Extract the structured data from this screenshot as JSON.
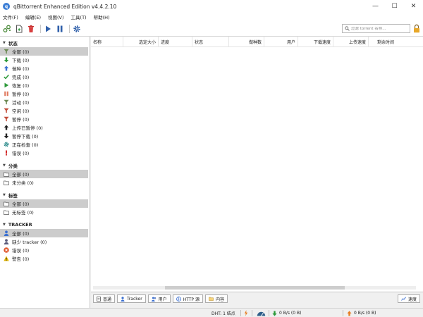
{
  "window": {
    "title": "qBittorrent Enhanced Edition v4.4.2.10",
    "minimize": "—",
    "maximize": "☐",
    "close": "✕"
  },
  "menu": [
    "文件(F)",
    "编辑(E)",
    "视图(V)",
    "工具(T)",
    "帮助(H)"
  ],
  "toolbar": {
    "search_placeholder": "过滤 torrent 名称..."
  },
  "sidebar": {
    "status": {
      "title": "状态",
      "items": [
        {
          "label": "全部 (0)",
          "icon": "filter-icon",
          "color": "#6d8a55"
        },
        {
          "label": "下载 (0)",
          "icon": "down-arrow-icon",
          "color": "#2d9a3a"
        },
        {
          "label": "做种 (0)",
          "icon": "up-arrow-icon",
          "color": "#3a6fd1"
        },
        {
          "label": "完成 (0)",
          "icon": "check-icon",
          "color": "#2d9a3a"
        },
        {
          "label": "恢复 (0)",
          "icon": "play-icon",
          "color": "#2d9a3a"
        },
        {
          "label": "暂停 (0)",
          "icon": "pause-icon",
          "color": "#e07a5f"
        },
        {
          "label": "活动 (0)",
          "icon": "filter-icon",
          "color": "#6d8a55"
        },
        {
          "label": "空闲 (0)",
          "icon": "filter-icon",
          "color": "#c24c3a"
        },
        {
          "label": "暂停 (0)",
          "icon": "filter-icon",
          "color": "#c24c3a"
        },
        {
          "label": "上传已暂停 (0)",
          "icon": "up-arrow-icon",
          "color": "#222222"
        },
        {
          "label": "暂停下载 (0)",
          "icon": "down-arrow-icon",
          "color": "#222222"
        },
        {
          "label": "正在检查 (0)",
          "icon": "gear-icon",
          "color": "#2a8a8a"
        },
        {
          "label": "错误 (0)",
          "icon": "exclamation-icon",
          "color": "#d22b2b"
        }
      ]
    },
    "category": {
      "title": "分类",
      "items": [
        {
          "label": "全部 (0)",
          "icon": "folder-icon",
          "color": "#555555"
        },
        {
          "label": "未分类 (0)",
          "icon": "folder-icon",
          "color": "#555555"
        }
      ]
    },
    "tags": {
      "title": "标签",
      "items": [
        {
          "label": "全部 (0)",
          "icon": "folder-icon",
          "color": "#555555"
        },
        {
          "label": "无标签 (0)",
          "icon": "folder-icon",
          "color": "#555555"
        }
      ]
    },
    "tracker": {
      "title": "TRACKER",
      "items": [
        {
          "label": "全部 (0)",
          "icon": "user-icon",
          "color": "#3a6fd1"
        },
        {
          "label": "缺少 tracker (0)",
          "icon": "user-icon",
          "color": "#5a5a7a"
        },
        {
          "label": "错误 (0)",
          "icon": "error-circle-icon",
          "color": "#e0562a"
        },
        {
          "label": "警告 (0)",
          "icon": "warning-icon",
          "color": "#e6b800"
        }
      ]
    }
  },
  "table": {
    "columns": [
      "名称",
      "选定大小",
      "进度",
      "状态",
      "做种数",
      "用户",
      "下载速度",
      "上传速度",
      "剩余时间"
    ]
  },
  "bottom_tabs": [
    "普通",
    "Tracker",
    "用户",
    "HTTP 源",
    "内容"
  ],
  "speed_button": "速度",
  "status": {
    "dht": "DHT: 1 结点",
    "download": "0 B/s (0 B)",
    "upload": "0 B/s (0 B)"
  }
}
